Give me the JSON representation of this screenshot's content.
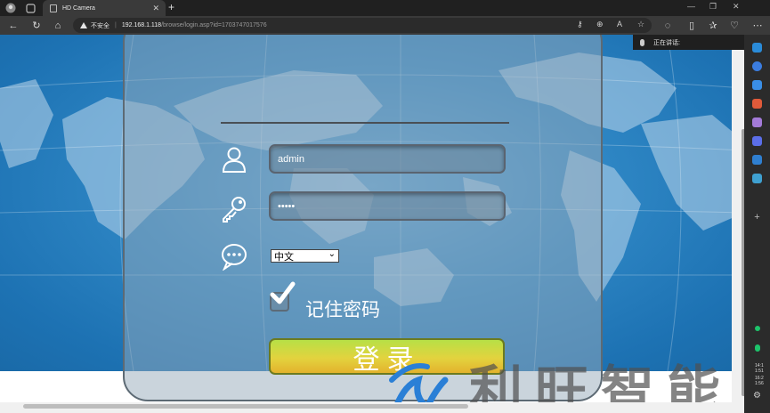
{
  "browser": {
    "tab_title": "HD Camera",
    "tab_close": "✕",
    "new_tab": "+",
    "security_label": "不安全",
    "url_host": "192.168.1.118",
    "url_path": "/browse/login.asp?id=1703747017576",
    "voice_status": "正在讲话:"
  },
  "login": {
    "username": "admin",
    "password_masked": "•••••",
    "language_selected": "中文",
    "remember_checked": true,
    "remember_label": "记住密码",
    "login_button": "登录"
  },
  "watermark": {
    "text": "利旺智能"
  },
  "sidebar": {
    "time_lines": [
      "14:1",
      "1:51",
      "16:2",
      "1:56"
    ]
  },
  "colors": {
    "map_blue": "#2e86c4",
    "login_green": "#b7e046",
    "login_yellow": "#e3b22d",
    "watermark_blue": "#2a7fd6"
  }
}
